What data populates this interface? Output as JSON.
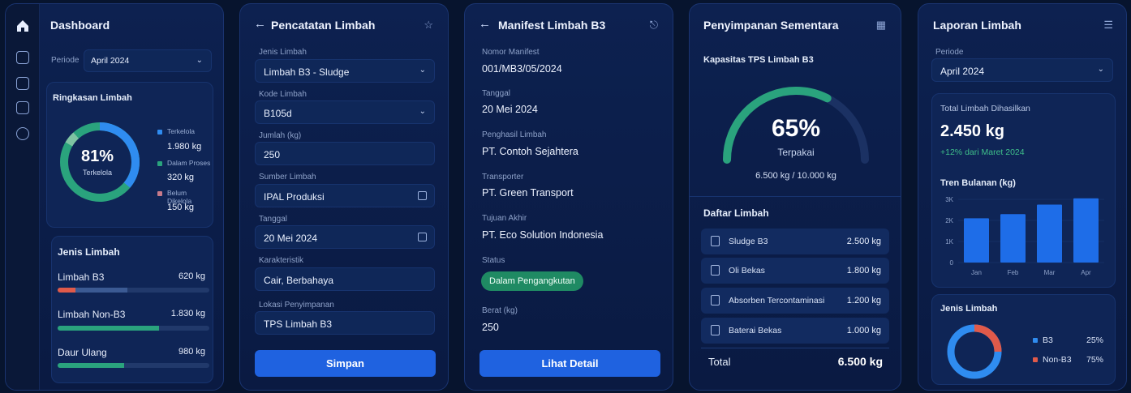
{
  "dashboard": {
    "title": "Dashboard",
    "period_label": "Periode",
    "period_value": "April 2024",
    "summary_title": "Ringkasan Limbah",
    "donut_pct": "81%",
    "donut_caption": "Terkelola",
    "legend": [
      {
        "label": "Terkelola",
        "value": "1.980 kg",
        "color": "#2f8cf0"
      },
      {
        "label": "Dalam Proses",
        "value": "320 kg",
        "color": "#2aa37d"
      },
      {
        "label": "Belum Dikelola",
        "value": "150 kg",
        "color": "#c77a8a"
      }
    ],
    "types_title": "Jenis Limbah",
    "types": [
      {
        "label": "Limbah B3",
        "value": "620 kg",
        "fraction": 0.46
      },
      {
        "label": "Limbah Non-B3",
        "value": "1.830 kg",
        "fraction": 0.67
      },
      {
        "label": "Daur Ulang",
        "value": "980 kg",
        "fraction": 0.44
      }
    ]
  },
  "pencatatan": {
    "title": "Pencatatan Limbah",
    "fields": [
      {
        "label": "Jenis Limbah",
        "value": "Limbah B3 - Sludge"
      },
      {
        "label": "Kode Limbah",
        "value": "B105d"
      },
      {
        "label": "Jumlah (kg)",
        "value": "250"
      },
      {
        "label": "Sumber Limbah",
        "value": "IPAL Produksi"
      },
      {
        "label": "Tanggal",
        "value": "20 Mei 2024"
      },
      {
        "label": "Karakteristik",
        "value": "Cair, Berbahaya"
      },
      {
        "label": "Lokasi Penyimpanan",
        "value": "TPS Limbah B3"
      }
    ],
    "save_button": "Simpan"
  },
  "manifest": {
    "title": "Manifest Limbah B3",
    "fields": [
      {
        "label": "Nomor Manifest",
        "value": "001/MB3/05/2024"
      },
      {
        "label": "Tanggal",
        "value": "20 Mei 2024"
      },
      {
        "label": "Penghasil Limbah",
        "value": "PT. Contoh Sejahtera"
      },
      {
        "label": "Transporter",
        "value": "PT. Green Transport"
      },
      {
        "label": "Tujuan Akhir",
        "value": "PT. Eco Solution Indonesia"
      }
    ],
    "status_label": "Status",
    "status_value": "Dalam Pengangkutan",
    "weight_label": "Berat (kg)",
    "weight_value": "250",
    "detail_button": "Lihat Detail"
  },
  "storage": {
    "title": "Penyimpanan Sementara",
    "capacity_title": "Kapasitas TPS Limbah B3",
    "gauge_pct": "65%",
    "gauge_fraction": 0.65,
    "gauge_caption": "Terpakai",
    "gauge_detail": "6.500 kg / 10.000 kg",
    "list_title": "Daftar Limbah",
    "items": [
      {
        "name": "Sludge B3",
        "value": "2.500 kg"
      },
      {
        "name": "Oli Bekas",
        "value": "1.800 kg"
      },
      {
        "name": "Absorben Tercontaminasi",
        "value": "1.200 kg"
      },
      {
        "name": "Baterai Bekas",
        "value": "1.000 kg"
      }
    ],
    "total_label": "Total",
    "total_value": "6.500 kg"
  },
  "report": {
    "title": "Laporan Limbah",
    "period_label": "Periode",
    "period_value": "April 2024",
    "total_title": "Total Limbah Dihasilkan",
    "total_value": "2.450 kg",
    "change": "+12% dari Maret 2024",
    "trend_title": "Tren Bulanan (kg)",
    "types_title": "Jenis Limbah",
    "types": [
      {
        "label": "B3",
        "value": "25%",
        "color": "#2f8cf0"
      },
      {
        "label": "Non-B3",
        "value": "75%",
        "color": "#e05a4a"
      }
    ]
  },
  "chart_data": {
    "type": "bar",
    "categories": [
      "Jan",
      "Feb",
      "Mar",
      "Apr"
    ],
    "values": [
      2100,
      2300,
      2750,
      3050
    ],
    "ylabel": "",
    "yticks": [
      "0",
      "1K",
      "2K",
      "3K"
    ],
    "ylim": [
      0,
      3000
    ]
  },
  "colors": {
    "accent": "#1f62e0",
    "green": "#2aa37d",
    "red": "#e05a4a"
  }
}
